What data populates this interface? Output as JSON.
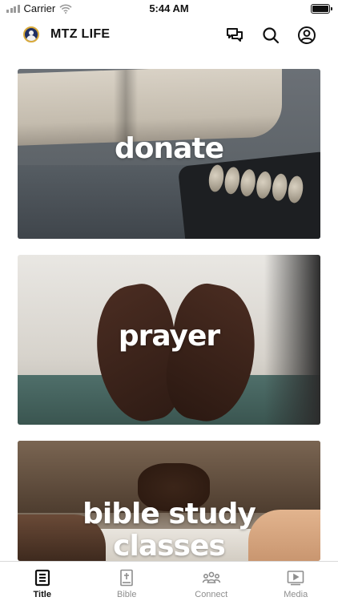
{
  "status_bar": {
    "carrier": "Carrier",
    "time": "5:44 AM"
  },
  "header": {
    "title": "MTZ LIFE"
  },
  "cards": [
    {
      "title": "donate"
    },
    {
      "title": "prayer"
    },
    {
      "title_line1": "bible study",
      "title_line2": "classes"
    }
  ],
  "tabs": [
    {
      "label": "Title",
      "icon": "title-icon",
      "active": true
    },
    {
      "label": "Bible",
      "icon": "bible-icon",
      "active": false
    },
    {
      "label": "Connect",
      "icon": "connect-icon",
      "active": false
    },
    {
      "label": "Media",
      "icon": "media-icon",
      "active": false
    }
  ],
  "colors": {
    "active_tab": "#111111",
    "inactive_tab": "#8e8e8e",
    "card_text": "#ffffff"
  }
}
